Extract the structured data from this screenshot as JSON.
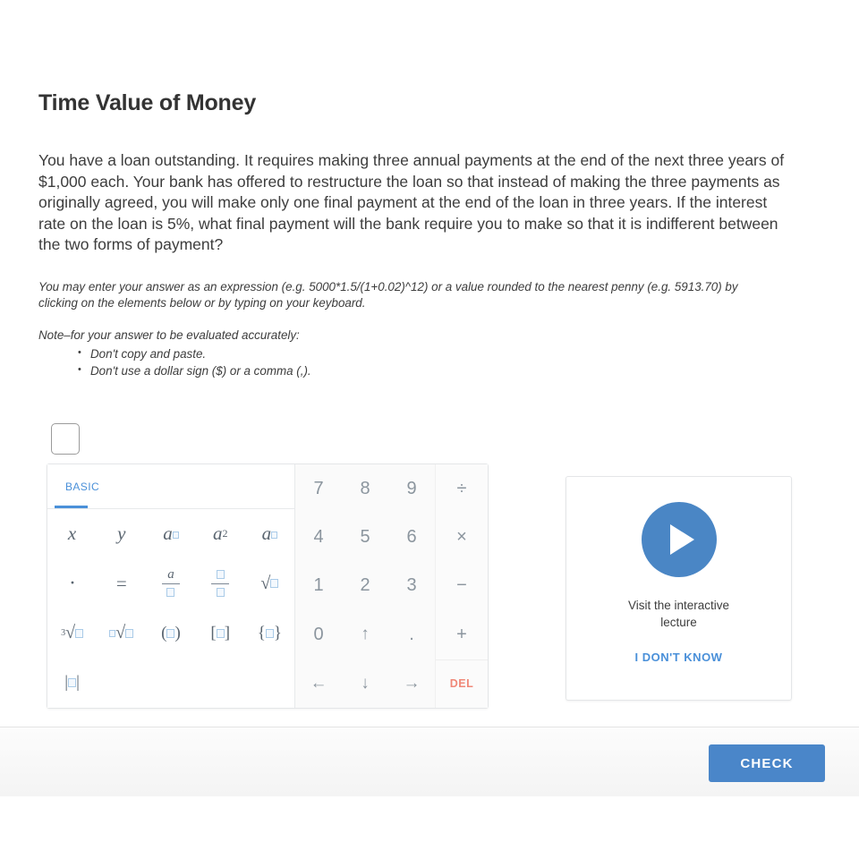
{
  "page": {
    "title": "Time Value of Money",
    "problem": "You have a loan outstanding. It requires making three annual payments at the end of the next three years of $1,000 each. Your bank has offered to restructure the loan so that instead of making the three payments as originally agreed, you will make only one final payment at the end of the loan in three years. If the interest rate on the loan is 5%, what final payment will the bank require you to make so that it is indifferent between the two forms of payment?",
    "hint": "You may enter your answer as an expression (e.g. 5000*1.5/(1+0.02)^12) or a value rounded to the nearest penny (e.g. 5913.70) by clicking on the elements below or by typing on your keyboard.",
    "note_intro": "Note–for your answer to be evaluated accurately:",
    "notes": [
      "Don't copy and paste.",
      "Don't use a dollar sign ($) or a comma (,)."
    ]
  },
  "answer": {
    "value": "",
    "placeholder": ""
  },
  "keyboard": {
    "tabs": [
      {
        "label": "BASIC",
        "active": true
      }
    ],
    "symbol_rows": [
      [
        {
          "name": "variable-x",
          "display": "x"
        },
        {
          "name": "variable-y",
          "display": "y"
        },
        {
          "name": "superscript",
          "display": "a□"
        },
        {
          "name": "a-squared",
          "display": "a²"
        },
        {
          "name": "subscript",
          "display": "a□"
        }
      ],
      [
        {
          "name": "multiply-dot",
          "display": "·"
        },
        {
          "name": "equals",
          "display": "="
        },
        {
          "name": "fraction-a",
          "display": "a/□"
        },
        {
          "name": "fraction-empty",
          "display": "□/□"
        },
        {
          "name": "square-root",
          "display": "√□"
        }
      ],
      [
        {
          "name": "cube-root",
          "display": "³√□"
        },
        {
          "name": "nth-root",
          "display": "□√□"
        },
        {
          "name": "parentheses",
          "display": "(□)"
        },
        {
          "name": "square-brackets",
          "display": "[□]"
        },
        {
          "name": "curly-braces",
          "display": "{□}"
        }
      ],
      [
        {
          "name": "absolute-value",
          "display": "|□|"
        }
      ]
    ],
    "digits": [
      "7",
      "8",
      "9",
      "4",
      "5",
      "6",
      "1",
      "2",
      "3",
      "0",
      "↑",
      ".",
      "←",
      "↓",
      "→"
    ],
    "operators": [
      "÷",
      "×",
      "−",
      "+"
    ],
    "delete_label": "DEL"
  },
  "lecture": {
    "caption": "Visit the interactive lecture",
    "link_label": "I DON'T KNOW",
    "play_icon": "play-icon"
  },
  "footer": {
    "check_label": "CHECK"
  },
  "colors": {
    "accent_blue": "#4a90d9",
    "button_blue": "#4a86c9",
    "play_blue": "#4a86c5",
    "delete_red": "#f08878",
    "placeholder_border": "#aacbe8",
    "text": "#3d3d3d"
  }
}
